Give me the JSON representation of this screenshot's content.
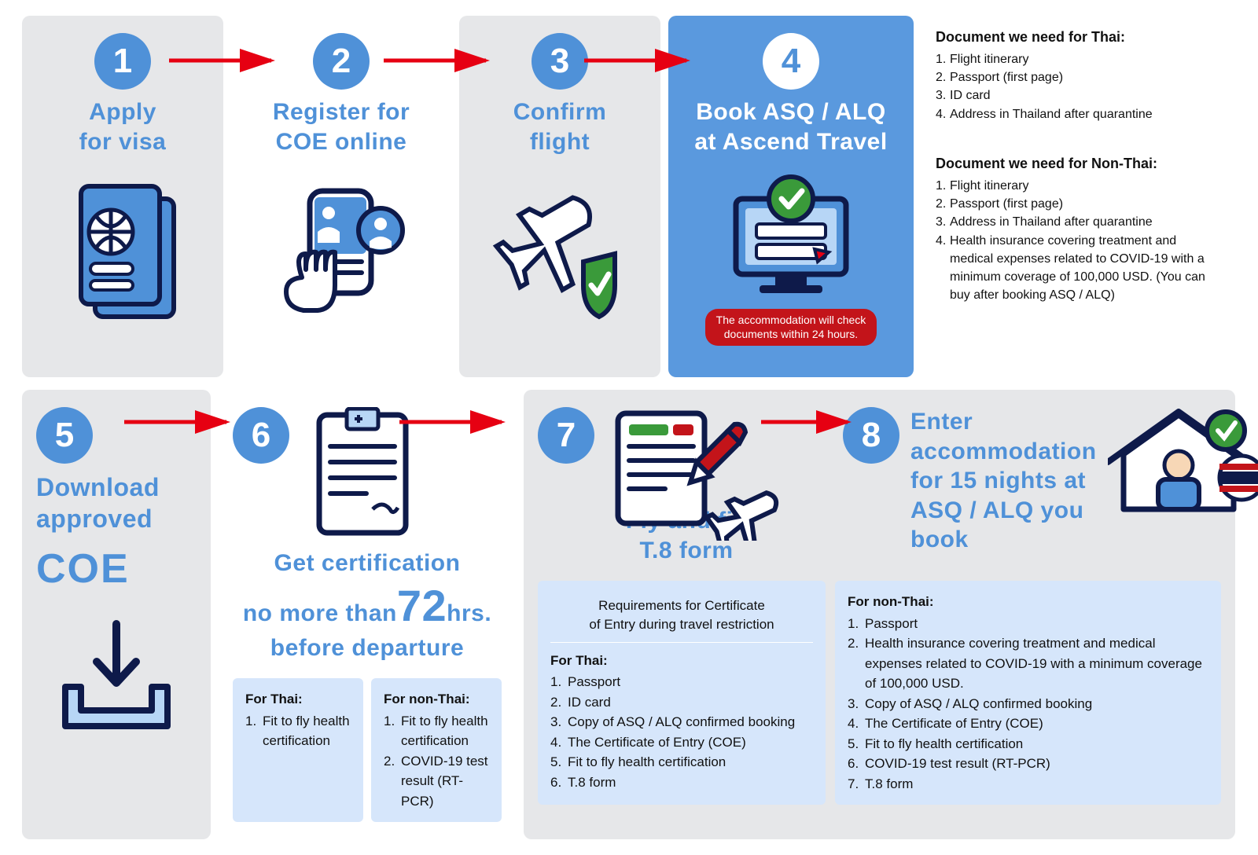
{
  "steps": {
    "s1": {
      "num": "1",
      "title": "Apply\nfor visa"
    },
    "s2": {
      "num": "2",
      "title": "Register for\nCOE online"
    },
    "s3": {
      "num": "3",
      "title": "Confirm\nflight"
    },
    "s4": {
      "num": "4",
      "title": "Book ASQ / ALQ\nat Ascend Travel",
      "notice": "The accommodation will check\ndocuments within 24 hours."
    },
    "s5": {
      "num": "5",
      "title_pre": "Download\napproved",
      "title_big": "COE"
    },
    "s6": {
      "num": "6",
      "title_a": "Get certification",
      "title_b": "no more than",
      "hours": "72",
      "title_c": "hrs.",
      "title_d": "before departure",
      "thai_h": "For Thai:",
      "thai_items": [
        "Fit to fly health certification"
      ],
      "non_h": "For non-Thai:",
      "non_items": [
        "Fit to fly health certification",
        "COVID-19 test result (RT-PCR)"
      ]
    },
    "s7": {
      "num": "7",
      "title": "Fly and fill\nT.8 form"
    },
    "s8": {
      "num": "8",
      "title": "Enter\naccommodation\nfor 15 nights at\nASQ / ALQ you book"
    }
  },
  "step4_docs": {
    "thai_h": "Document we need for Thai:",
    "thai_items": [
      "Flight itinerary",
      "Passport (first page)",
      "ID card",
      "Address in Thailand after quarantine"
    ],
    "non_h": "Document we need for Non-Thai:",
    "non_items": [
      "Flight itinerary",
      "Passport (first page)",
      "Address in Thailand after quarantine",
      "Health insurance covering treatment and medical expenses related to COVID-19 with a minimum coverage of 100,000 USD. (You can buy after booking ASQ / ALQ)"
    ]
  },
  "step7_req": {
    "title": "Requirements for Certificate\nof Entry during travel restriction",
    "thai_h": "For Thai:",
    "thai_items": [
      "Passport",
      "ID card",
      "Copy of ASQ / ALQ confirmed booking",
      "The Certificate of Entry (COE)",
      "Fit to fly health certification",
      "T.8 form"
    ],
    "non_h": "For non-Thai:",
    "non_items": [
      "Passport",
      "Health insurance covering treatment and medical expenses related to COVID-19 with a minimum coverage of 100,000 USD.",
      "Copy of ASQ / ALQ confirmed booking",
      "The Certificate of Entry (COE)",
      "Fit to fly health certification",
      "COVID-19 test result (RT-PCR)",
      "T.8 form"
    ]
  }
}
